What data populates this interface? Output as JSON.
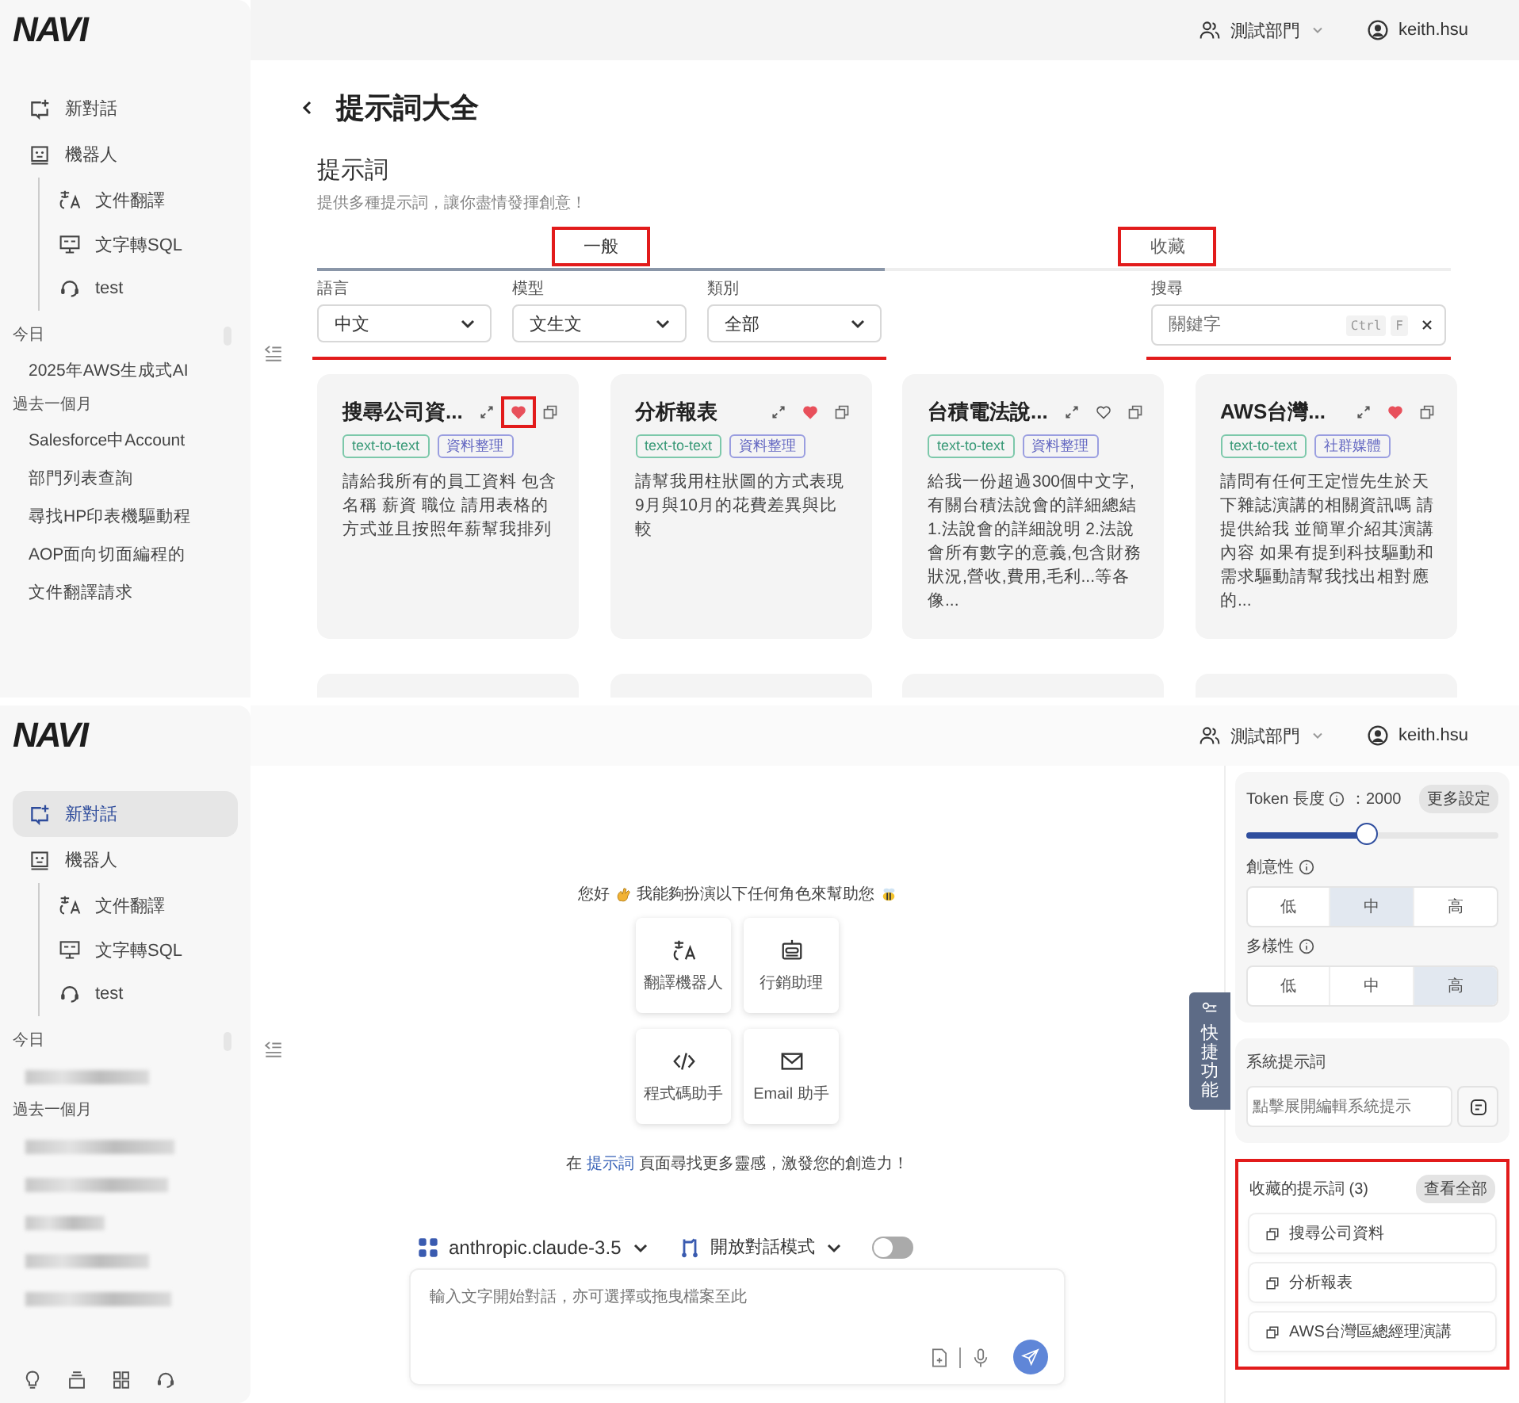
{
  "screens": [
    {
      "kind": "prompt-library",
      "header": {
        "department": "測試部門",
        "user": "keith.hsu"
      },
      "sidebar": {
        "logo": "NAVI",
        "nav": [
          {
            "kind": "new-chat",
            "label": "新對話",
            "selected": false
          },
          {
            "kind": "bots",
            "label": "機器人",
            "selected": false,
            "children": [
              {
                "kind": "translate",
                "label": "文件翻譯",
                "selected": false
              },
              {
                "kind": "sql",
                "label": "文字轉SQL",
                "selected": false
              },
              {
                "kind": "support",
                "label": "test",
                "selected": false
              }
            ]
          }
        ],
        "history": [
          {
            "heading": "今日",
            "items": [
              {
                "kind": "text",
                "label": "2025年AWS生成式AI"
              }
            ]
          },
          {
            "heading": "過去一個月",
            "items": [
              {
                "kind": "text",
                "label": "Salesforce中Account"
              },
              {
                "kind": "text",
                "label": "部門列表查詢"
              },
              {
                "kind": "text",
                "label": "尋找HP印表機驅動程"
              },
              {
                "kind": "text",
                "label": "AOP面向切面編程的"
              },
              {
                "kind": "text",
                "label": "文件翻譯請求"
              }
            ]
          }
        ]
      },
      "page": {
        "title": "提示詞大全",
        "section": "提示詞",
        "subtitle": "提供多種提示詞，讓你盡情發揮創意！",
        "tabs": [
          {
            "label": "一般",
            "selected": true,
            "annotated": true
          },
          {
            "label": "收藏",
            "selected": false,
            "annotated": true
          }
        ],
        "filters": {
          "annotated": true,
          "selects": [
            {
              "label": "語言",
              "value": "中文"
            },
            {
              "label": "模型",
              "value": "文生文"
            },
            {
              "label": "類別",
              "value": "全部"
            }
          ],
          "search": {
            "label": "搜尋",
            "placeholder": "關鍵字",
            "keys": [
              "Ctrl",
              "F"
            ]
          }
        },
        "cards": [
          {
            "title": "搜尋公司資...",
            "favorite": true,
            "annotated": true,
            "tags": [
              {
                "label": "text-to-text",
                "kind": "type"
              },
              {
                "label": "資料整理",
                "kind": "category"
              }
            ],
            "text": "請給我所有的員工資料 包含名稱 薪資 職位 請用表格的方式並且按照年薪幫我排列"
          },
          {
            "title": "分析報表",
            "favorite": true,
            "annotated": false,
            "tags": [
              {
                "label": "text-to-text",
                "kind": "type"
              },
              {
                "label": "資料整理",
                "kind": "category"
              }
            ],
            "text": "請幫我用柱狀圖的方式表現9月與10月的花費差異與比較"
          },
          {
            "title": "台積電法說...",
            "favorite": false,
            "annotated": false,
            "tags": [
              {
                "label": "text-to-text",
                "kind": "type"
              },
              {
                "label": "資料整理",
                "kind": "category"
              }
            ],
            "text": "給我一份超過300個中文字,有關台積法說會的詳細總結 1.法說會的詳細說明 2.法說會所有數字的意義,包含財務狀況,營收,費用,毛利...等各像..."
          },
          {
            "title": "AWS台灣...",
            "favorite": true,
            "annotated": false,
            "tags": [
              {
                "label": "text-to-text",
                "kind": "type"
              },
              {
                "label": "社群媒體",
                "kind": "category"
              }
            ],
            "text": "請問有任何王定愷先生於天下雜誌演講的相關資訊嗎 請提供給我 並簡單介紹其演講內容 如果有提到科技驅動和需求驅動請幫我找出相對應的..."
          }
        ]
      }
    },
    {
      "kind": "chat",
      "header": {
        "department": "測試部門",
        "user": "keith.hsu"
      },
      "sidebar": {
        "logo": "NAVI",
        "nav": [
          {
            "kind": "new-chat",
            "label": "新對話",
            "selected": true
          },
          {
            "kind": "bots",
            "label": "機器人",
            "selected": false,
            "children": [
              {
                "kind": "translate",
                "label": "文件翻譯",
                "selected": false
              },
              {
                "kind": "sql",
                "label": "文字轉SQL",
                "selected": false
              },
              {
                "kind": "support",
                "label": "test",
                "selected": false
              }
            ]
          }
        ],
        "history": [
          {
            "heading": "今日",
            "items": [
              {
                "kind": "redacted"
              }
            ]
          },
          {
            "heading": "過去一個月",
            "items": [
              {
                "kind": "redacted"
              },
              {
                "kind": "redacted"
              },
              {
                "kind": "redacted"
              },
              {
                "kind": "redacted"
              },
              {
                "kind": "redacted"
              }
            ]
          }
        ]
      },
      "chat": {
        "greeting": {
          "hello": "您好",
          "text": "我能夠扮演以下任何角色來幫助您"
        },
        "roles": [
          {
            "kind": "translate",
            "label": "翻譯機器人"
          },
          {
            "kind": "bot",
            "label": "行銷助理"
          },
          {
            "kind": "code",
            "label": "程式碼助手"
          },
          {
            "kind": "mail",
            "label": "Email 助手"
          }
        ],
        "hint": {
          "before": "在",
          "link": "提示詞",
          "after": "頁面尋找更多靈感，激發您的創造力！"
        },
        "model": "anthropic.claude-3.5",
        "mode": "開放對話模式",
        "mode_on": false,
        "input": {
          "placeholder": "輸入文字開始對話，亦可選擇或拖曳檔案至此"
        },
        "quick_tab": "快捷功能"
      },
      "settings": {
        "token_label": "Token 長度",
        "token_value": "：2000",
        "more": "更多設定",
        "level": 0.48,
        "groups": [
          {
            "label": "創意性",
            "options": [
              {
                "label": "低",
                "selected": false
              },
              {
                "label": "中",
                "selected": true
              },
              {
                "label": "高",
                "selected": false
              }
            ]
          },
          {
            "label": "多樣性",
            "options": [
              {
                "label": "低",
                "selected": false
              },
              {
                "label": "中",
                "selected": false
              },
              {
                "label": "高",
                "selected": true
              }
            ]
          }
        ]
      },
      "system_prompt": {
        "title": "系統提示詞",
        "placeholder": "點擊展開編輯系統提示"
      },
      "favorites": {
        "title": "收藏的提示詞 (3)",
        "view_all": "查看全部",
        "annotated": true,
        "items": [
          {
            "label": "搜尋公司資料"
          },
          {
            "label": "分析報表"
          },
          {
            "label": "AWS台灣區總經理演講"
          }
        ]
      }
    }
  ]
}
